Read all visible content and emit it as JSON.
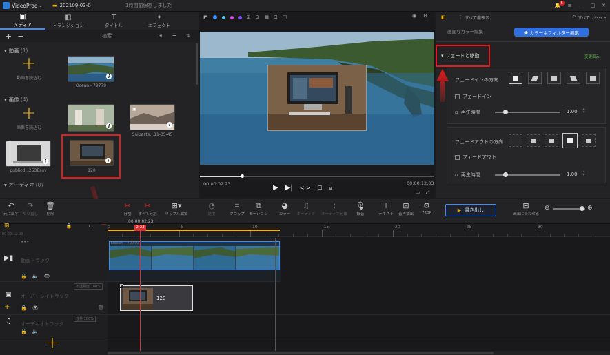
{
  "app": {
    "name": "VideoProc",
    "project": "202109-03-0",
    "autosave": "1時間前保存しました",
    "notif_count": "6"
  },
  "tabs": [
    {
      "label": "メディア",
      "icon": "media-icon"
    },
    {
      "label": "トランジション",
      "icon": "transition-icon"
    },
    {
      "label": "タイトル",
      "icon": "title-icon"
    },
    {
      "label": "エフェクト",
      "icon": "effect-icon"
    }
  ],
  "media_tools": {
    "add": "+",
    "remove": "−",
    "search_placeholder": "検索..."
  },
  "categories": {
    "video": {
      "title": "動画",
      "count": "(1)",
      "add_label": "動画を読込む",
      "items": [
        {
          "name": "Ocean - 79779"
        }
      ]
    },
    "image": {
      "title": "画像",
      "count": "(4)",
      "add_label": "画像を読込む",
      "items": [
        {
          "name": ""
        },
        {
          "name": "Snipaste...11-35-45"
        },
        {
          "name": "publicd...2538suv"
        },
        {
          "name": "120"
        }
      ]
    },
    "audio": {
      "title": "オーディオ",
      "count": "(0)"
    }
  },
  "preview": {
    "time_current": "00:00:02.23",
    "time_total": "00:00:12.03",
    "progress": 0.18
  },
  "right_panel": {
    "tab_label": "すべて非表示",
    "reset_label": "すべてリセット",
    "color_edit_label": "画面なカラー編集",
    "color_filter_btn": "カラー＆フィルター編集",
    "section_title": "フェードと移動",
    "applied_label": "変更済み",
    "fade_in": {
      "direction_label": "フェードインの方向",
      "checkbox_label": "フェードイン",
      "duration_label": "再生時間",
      "duration_value": "1.00"
    },
    "fade_out": {
      "direction_label": "フェードアウトの方向",
      "checkbox_label": "フェードアウト",
      "duration_label": "再生時間",
      "duration_value": "1.00"
    }
  },
  "toolbar": {
    "undo": "元に戻す",
    "redo": "やり直し",
    "delete": "削除",
    "split": "分割",
    "split_all": "すべて分割",
    "ripple": "リップル編集",
    "speed": "速度",
    "crop": "クロップ",
    "motion": "モーション",
    "color": "カラー",
    "audio": "オーディオ",
    "audio_split": "オーディオ分離",
    "record": "録音",
    "text": "テキスト",
    "extract": "音声抽出",
    "res": "720P",
    "export": "書き出し",
    "fit": "画面に合わせる",
    "zoom": 0.9
  },
  "timeline": {
    "playhead_time": "00:00:02.23",
    "playhead_label": "2.23",
    "ticks": [
      "0",
      "5",
      "10",
      "15",
      "20",
      "25",
      "30"
    ],
    "left_time": "00:00:12.03",
    "video_track": {
      "label": "動画トラック",
      "clip_name": "Ocean - 79779"
    },
    "overlay_track": {
      "label": "オーバーレイトラック",
      "badge": "不透明度 100%",
      "clip_name": "120"
    },
    "audio_track": {
      "label": "オーディオトラック",
      "badge": "音量 100%"
    }
  },
  "colors": {
    "accent": "#3b8cff",
    "highlight": "#e31b1b",
    "plus": "#f4b400",
    "playhead": "#e03030"
  }
}
